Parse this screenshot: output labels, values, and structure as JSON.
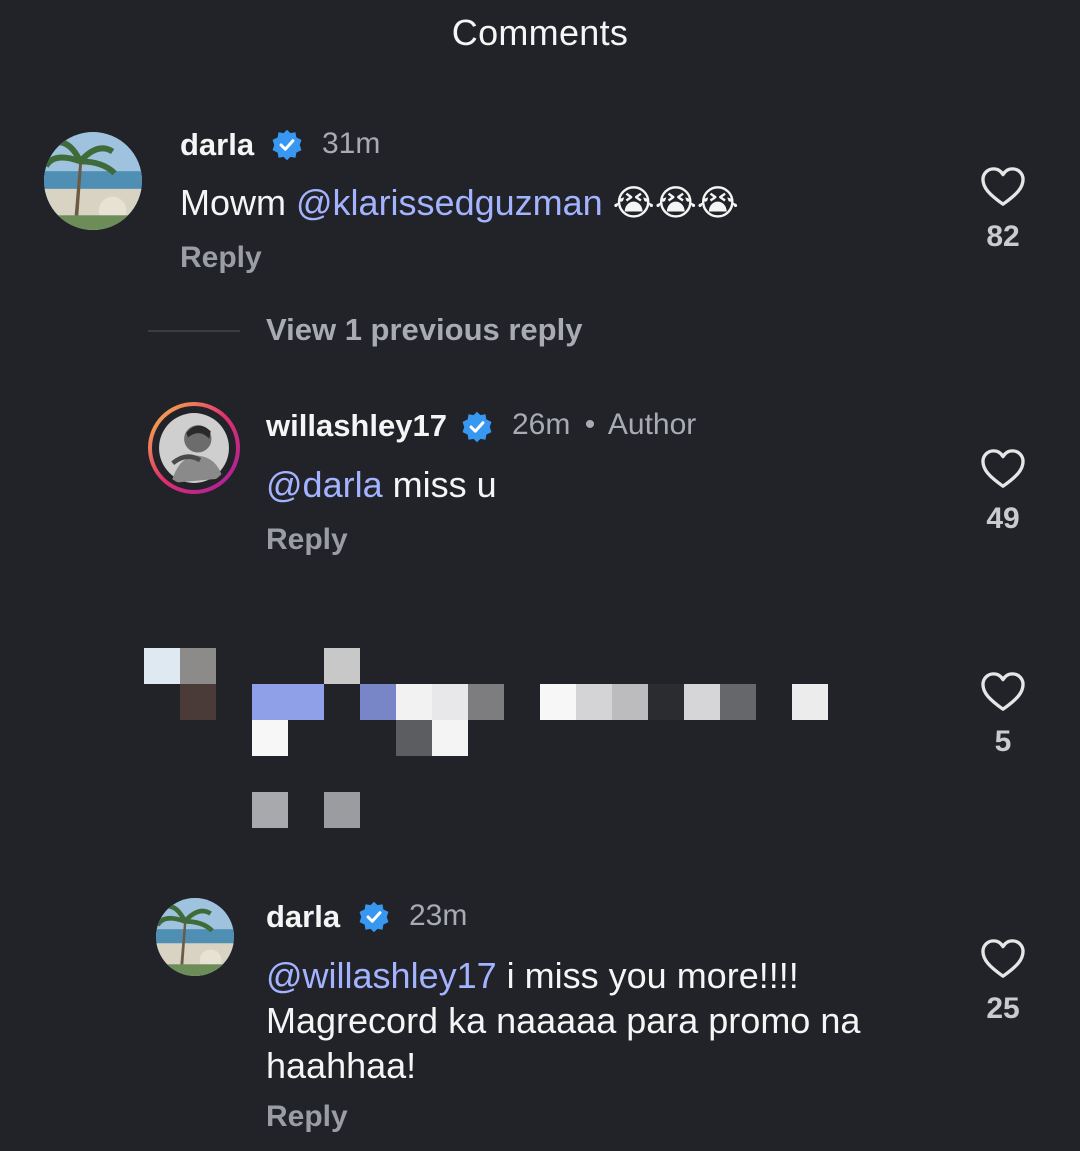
{
  "header": {
    "title": "Comments"
  },
  "comments": [
    {
      "username": "darla",
      "time": "31m",
      "text_plain": "Mowm ",
      "mention": "@klarissedguzman",
      "emoji": " 😭😭😭",
      "reply_label": "Reply",
      "likes": "82"
    },
    {
      "username": "willashley17",
      "time": "26m",
      "author_tag": "Author",
      "separator": "•",
      "mention": "@darla",
      "text_plain": " miss u",
      "reply_label": "Reply",
      "likes": "49"
    },
    {
      "likes": "5"
    },
    {
      "username": "darla",
      "time": "23m",
      "mention": "@willashley17",
      "line1": " i miss you more!!!!",
      "line2": "Magrecord ka naaaaa para promo na",
      "line3": "haahhaa!",
      "reply_label": "Reply",
      "likes": "25"
    }
  ],
  "view_replies": "View 1 previous reply",
  "colors": {
    "background": "#212328",
    "mention": "#a4b3ff",
    "verified": "#3897f0"
  }
}
